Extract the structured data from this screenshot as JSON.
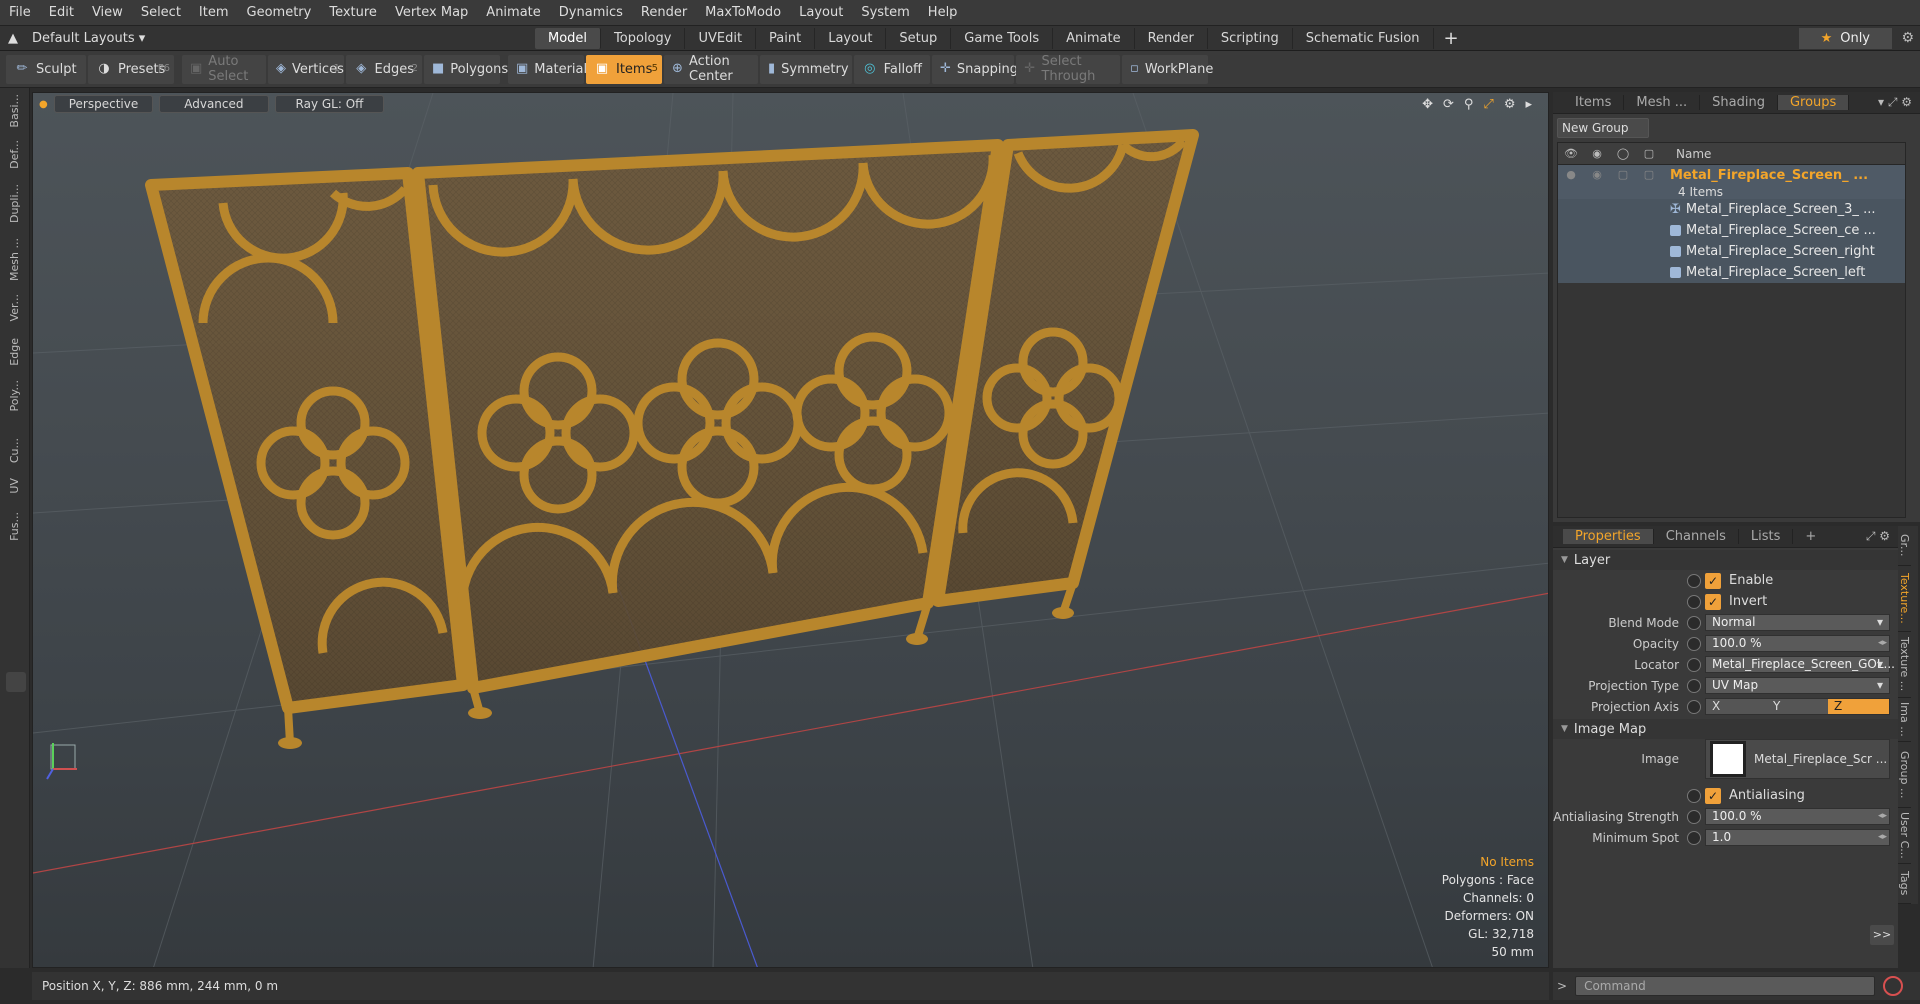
{
  "menu": [
    "File",
    "Edit",
    "View",
    "Select",
    "Item",
    "Geometry",
    "Texture",
    "Vertex Map",
    "Animate",
    "Dynamics",
    "Render",
    "MaxToModo",
    "Layout",
    "System",
    "Help"
  ],
  "layout_selector": "Default Layouts",
  "mode_tabs": [
    {
      "label": "Model",
      "active": true
    },
    {
      "label": "Topology"
    },
    {
      "label": "UVEdit"
    },
    {
      "label": "Paint"
    },
    {
      "label": "Layout"
    },
    {
      "label": "Setup"
    },
    {
      "label": "Game Tools"
    },
    {
      "label": "Animate"
    },
    {
      "label": "Render"
    },
    {
      "label": "Scripting"
    },
    {
      "label": "Schematic Fusion"
    }
  ],
  "only_label": "Only",
  "toolbar": {
    "sculpt": "Sculpt",
    "presets": "Presets",
    "presets_key": "F6",
    "auto_select": "Auto Select",
    "vertices": "Vertices",
    "vertices_key": "1",
    "edges": "Edges",
    "edges_key": "2",
    "polygons": "Polygons",
    "materials": "Materials",
    "items": "Items",
    "items_key": "5",
    "action_center": "Action Center",
    "symmetry": "Symmetry",
    "falloff": "Falloff",
    "snapping": "Snapping",
    "select_through": "Select Through",
    "workplane": "WorkPlane"
  },
  "left_tabs": [
    "Basi...",
    "Def...",
    "Dupli...",
    "Mesh ...",
    "Ver...",
    "Edge",
    "Poly...",
    "Cu...",
    "UV",
    "Fus..."
  ],
  "viewport": {
    "view": "Perspective",
    "shading": "Advanced",
    "raygl": "Ray GL: Off",
    "info": {
      "items": "No Items",
      "polygons": "Polygons : Face",
      "channels": "Channels: 0",
      "deformers": "Deformers: ON",
      "gl": "GL: 32,718",
      "focal": "50 mm"
    }
  },
  "status": "Position X, Y, Z:  886 mm, 244 mm, 0 m",
  "groups_panel": {
    "tabs": [
      "Items",
      "Mesh ...",
      "Shading",
      "Groups"
    ],
    "active_tab": "Groups",
    "new_group": "New Group",
    "name_header": "Name",
    "group_name": "Metal_Fireplace_Screen_ ...",
    "group_count": "4 Items",
    "children": [
      "Metal_Fireplace_Screen_3_ ...",
      "Metal_Fireplace_Screen_ce ...",
      "Metal_Fireplace_Screen_right",
      "Metal_Fireplace_Screen_left"
    ]
  },
  "properties_panel": {
    "tabs": [
      "Properties",
      "Channels",
      "Lists"
    ],
    "layer_section": "Layer",
    "enable": "Enable",
    "invert": "Invert",
    "blend_mode_label": "Blend Mode",
    "blend_mode": "Normal",
    "opacity_label": "Opacity",
    "opacity": "100.0 %",
    "locator_label": "Locator",
    "locator": "Metal_Fireplace_Screen_GOL...",
    "projection_type_label": "Projection Type",
    "projection_type": "UV Map",
    "projection_axis_label": "Projection Axis",
    "axes": [
      "X",
      "Y",
      "Z"
    ],
    "active_axis": "Z",
    "image_map_section": "Image Map",
    "image_label": "Image",
    "image": "Metal_Fireplace_Scr ...",
    "antialiasing": "Antialiasing",
    "aa_strength_label": "Antialiasing Strength",
    "aa_strength": "100.0 %",
    "min_spot_label": "Minimum Spot",
    "min_spot": "1.0"
  },
  "right_tabs": [
    "Gr...",
    "Texture...",
    "Texture ...",
    "Ima ...",
    "Group ...",
    "User C...",
    "Tags"
  ],
  "command_placeholder": "Command",
  "colors": {
    "accent": "#f0a13a",
    "frame": "#b8862c",
    "screen": "#6e5a3a"
  }
}
